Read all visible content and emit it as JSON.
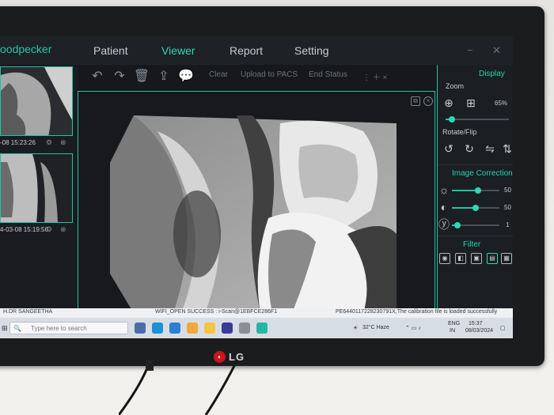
{
  "app": {
    "name": "oodpecker",
    "main_tabs": [
      "Patient",
      "Viewer",
      "Report",
      "Setting"
    ],
    "active_tab": "Viewer"
  },
  "toolbar": {
    "clear": "Clear",
    "upload": "Upload to PACS",
    "end_status": "End Status"
  },
  "thumbnails": [
    {
      "date": "-08 15:23:26"
    },
    {
      "date": "4-03-08 15:19:56"
    }
  ],
  "right_panel": {
    "display_title": "Display",
    "zoom_label": "Zoom",
    "zoom_value": "65%",
    "rotate_label": "Rotate/Flip",
    "image_correction_title": "Image Correction",
    "brightness_value": "50",
    "contrast_value": "50",
    "gamma_value": "1",
    "filter_title": "Filter",
    "brightness_level": 0.55,
    "contrast_level": 0.5,
    "gamma_level": 0.12,
    "zoom_level": 0.1
  },
  "status_bar": {
    "doctor": "H.DR SANGEETHA",
    "wifi": "WIFI_OPEN SUCCESS : i-Scan@1EBFCE286F1",
    "calibration": "PE6440117228230791X,The calibration file is loaded successfully"
  },
  "taskbar": {
    "search_placeholder": "Type here to search",
    "weather": "32°C Haze",
    "language": "ENG",
    "region": "IN",
    "time": "15:37",
    "date": "08/03/2024"
  },
  "monitor": {
    "brand": "LG"
  },
  "colors": {
    "accent": "#22c4a6",
    "background": "#16181b"
  }
}
